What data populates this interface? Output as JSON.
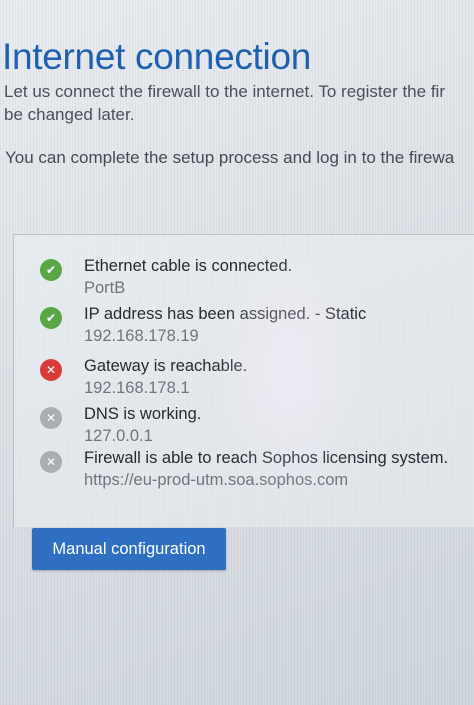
{
  "page": {
    "title": "Internet connection",
    "intro_line1": "Let us connect the firewall to the internet. To register the fir",
    "intro_line2": "be changed later.",
    "subtitle": "You can complete the setup process and log in to the firewa"
  },
  "checks": [
    {
      "status": "success",
      "icon": "check-icon",
      "label": "Ethernet cable is connected.",
      "detail": "PortB"
    },
    {
      "status": "success",
      "icon": "check-icon",
      "label": "IP address has been assigned. - Static",
      "detail": "192.168.178.19"
    },
    {
      "status": "error",
      "icon": "x-icon",
      "label": "Gateway is reachable.",
      "detail": "192.168.178.1"
    },
    {
      "status": "pending",
      "icon": "x-icon",
      "label": "DNS is working.",
      "detail": "127.0.0.1"
    },
    {
      "status": "pending",
      "icon": "x-icon",
      "label": "Firewall is able to reach Sophos licensing system.",
      "detail": "https://eu-prod-utm.soa.sophos.com"
    }
  ],
  "actions": {
    "manual_config_label": "Manual configuration"
  },
  "colors": {
    "title": "#1f5fb0",
    "success": "#5aa545",
    "error": "#d93a3a",
    "pending": "#a9aeb3",
    "button": "#2f6fc2"
  }
}
